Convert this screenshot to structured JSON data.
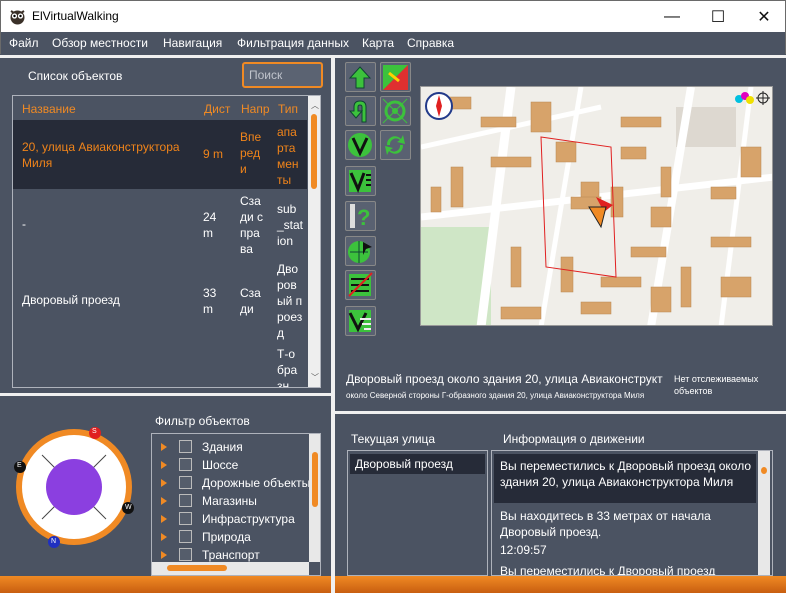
{
  "window": {
    "title": "ElVirtualWalking",
    "minimize": "—",
    "maximize": "☐",
    "close": "✕"
  },
  "menu": [
    "Файл",
    "Обзор местности",
    "Навигация",
    "Фильтрация данных",
    "Карта",
    "Справка"
  ],
  "objects": {
    "title": "Список объектов",
    "search_placeholder": "Поиск",
    "columns": [
      "Название",
      "Дист",
      "Напр",
      "Тип"
    ],
    "rows": [
      {
        "name": "20, улица Авиаконструктора Миля",
        "dist": "9 m",
        "dir": "Впереди",
        "type": "апартаменты",
        "selected": true
      },
      {
        "name": "-",
        "dist": "24 m",
        "dir": "Сзади справа",
        "type": "sub_station",
        "selected": false
      },
      {
        "name": "Дворовый проезд",
        "dist": "33 m",
        "dir": "Сзади",
        "type": "Дворовый проезд",
        "selected": false
      },
      {
        "name": "",
        "dist": "",
        "dir": "",
        "type": "Т-образн",
        "selected": false
      }
    ]
  },
  "compass": {
    "s": "S",
    "e": "E",
    "w": "W",
    "n": "N"
  },
  "filter": {
    "title": "Фильтр объектов",
    "items": [
      "Здания",
      "Шоссе",
      "Дорожные объекты",
      "Магазины",
      "Инфраструктура",
      "Природа",
      "Транспорт"
    ]
  },
  "map": {
    "status_line1": "Дворовый проезд около здания 20, улица Авиаконструкт",
    "status_line2": "около Северной стороны Г-образного здания 20, улица Авиаконструктора Миля",
    "tracking_line1": "Нет отслеживаемых",
    "tracking_line2": "объектов"
  },
  "street": {
    "title": "Текущая улица",
    "current": "Дворовый проезд"
  },
  "movement": {
    "title": "Информация о движении",
    "messages": [
      "Вы переместились к Дворовый проезд около здания 20, улица Авиаконструктора Миля",
      "Вы находитесь в 33 метрах от начала Дворовый проезд.",
      "12:09:57",
      "Вы переместились к Дворовый проезд"
    ]
  },
  "colors": {
    "accent": "#f08a24",
    "panel": "#4b5362",
    "selected_row": "#262b38"
  }
}
